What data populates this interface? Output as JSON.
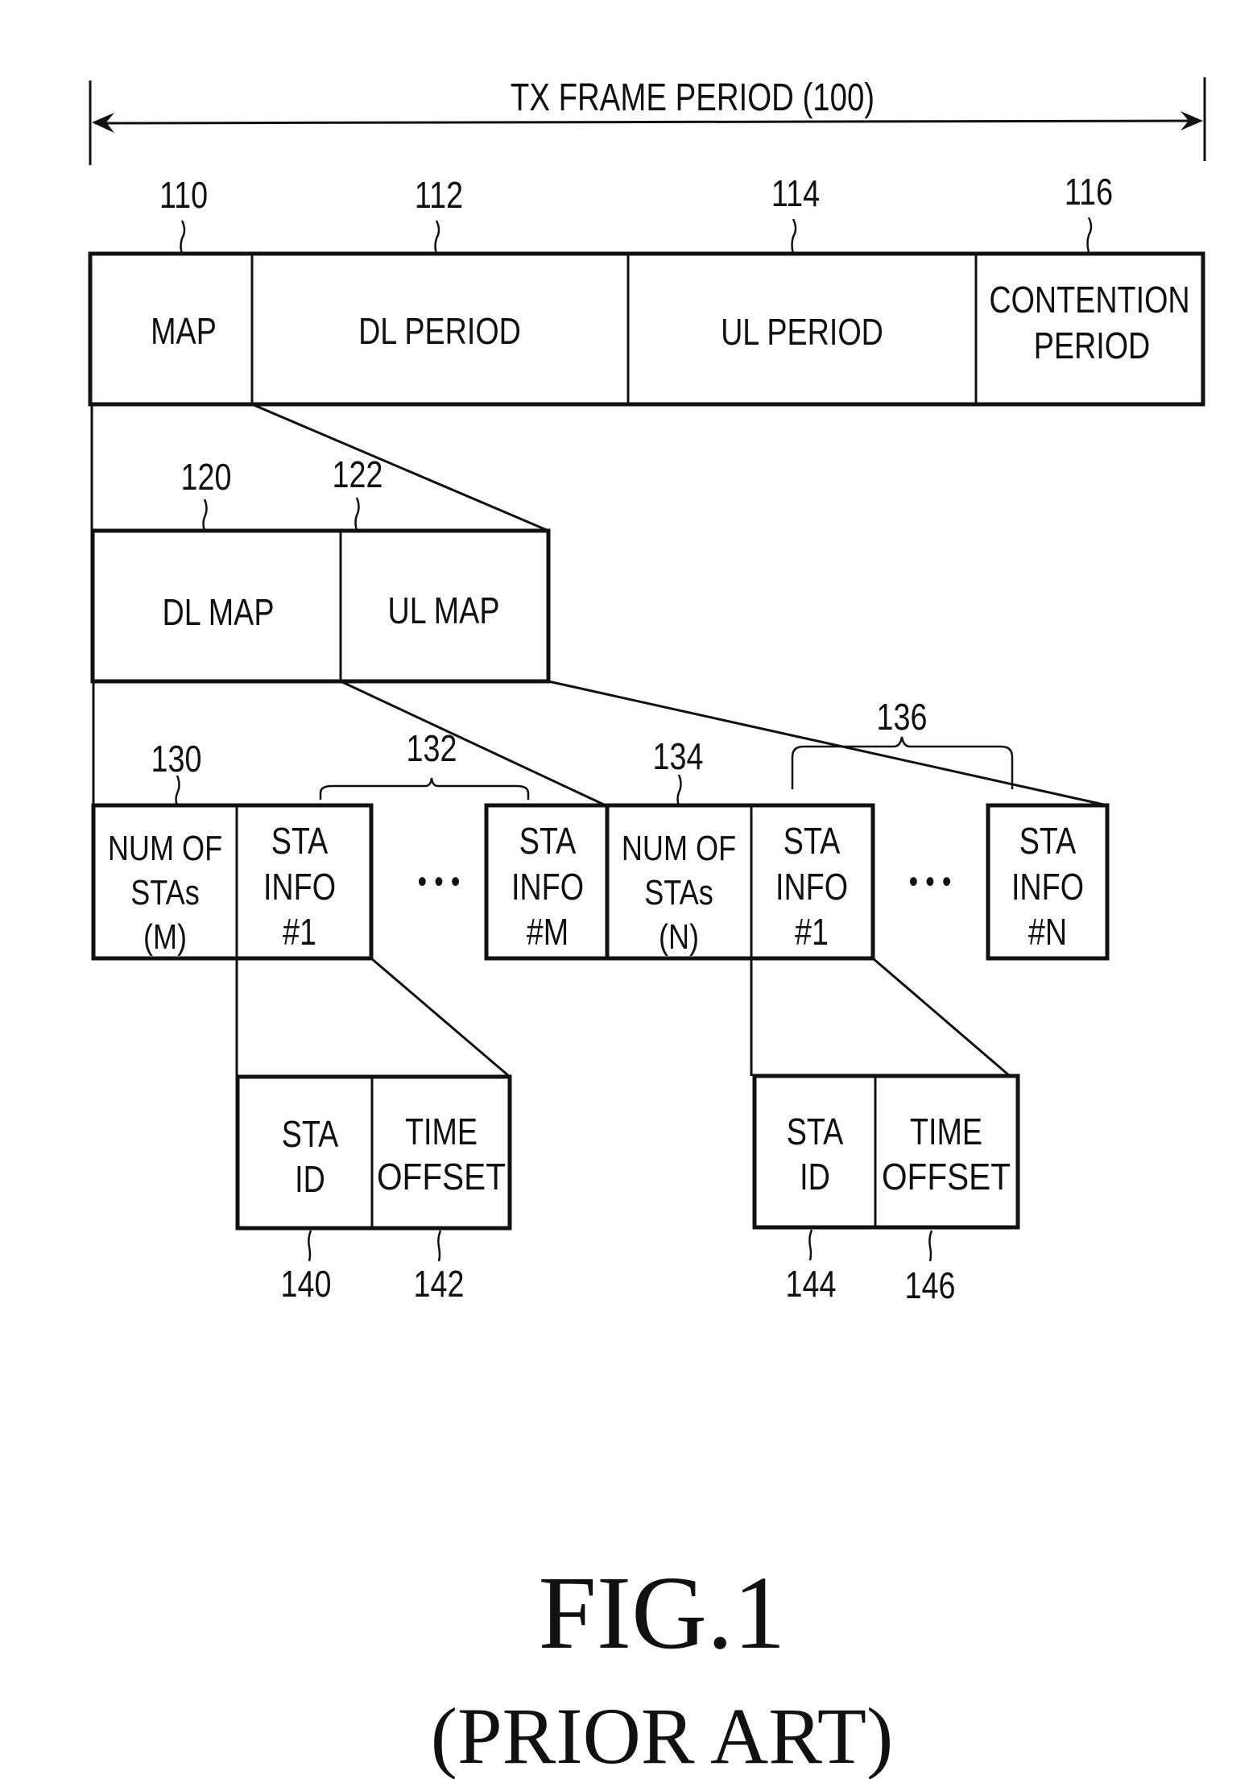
{
  "figure": {
    "title": "FIG.1",
    "subtitle": "(PRIOR ART)"
  },
  "frame_period": {
    "label": "TX FRAME PERIOD (100)"
  },
  "frame": {
    "fields": [
      {
        "ref": "110",
        "lines": [
          "MAP"
        ]
      },
      {
        "ref": "112",
        "lines": [
          "DL PERIOD"
        ]
      },
      {
        "ref": "114",
        "lines": [
          "UL PERIOD"
        ]
      },
      {
        "ref": "116",
        "lines": [
          "CONTENTION",
          "PERIOD"
        ]
      }
    ]
  },
  "map": {
    "fields": [
      {
        "ref": "120",
        "lines": [
          "DL MAP"
        ]
      },
      {
        "ref": "122",
        "lines": [
          "UL MAP"
        ]
      }
    ]
  },
  "dl_map": {
    "count_field": {
      "ref": "130",
      "lines": [
        "NUM OF",
        "STAs",
        "(M)"
      ]
    },
    "first_info": {
      "lines": [
        "STA",
        "INFO",
        "#1"
      ]
    },
    "last_info": {
      "lines": [
        "STA",
        "INFO",
        "#M"
      ]
    },
    "group_ref": "132",
    "ellipsis": "• • •"
  },
  "ul_map": {
    "count_field": {
      "ref": "134",
      "lines": [
        "NUM OF",
        "STAs",
        "(N)"
      ]
    },
    "first_info": {
      "lines": [
        "STA",
        "INFO",
        "#1"
      ]
    },
    "last_info": {
      "lines": [
        "STA",
        "INFO",
        "#N"
      ]
    },
    "group_ref": "136",
    "ellipsis": "• • •"
  },
  "dl_sta_info": {
    "fields": [
      {
        "ref": "140",
        "lines": [
          "STA",
          "ID"
        ]
      },
      {
        "ref": "142",
        "lines": [
          "TIME",
          "OFFSET"
        ]
      }
    ]
  },
  "ul_sta_info": {
    "fields": [
      {
        "ref": "144",
        "lines": [
          "STA",
          "ID"
        ]
      },
      {
        "ref": "146",
        "lines": [
          "TIME",
          "OFFSET"
        ]
      }
    ]
  }
}
